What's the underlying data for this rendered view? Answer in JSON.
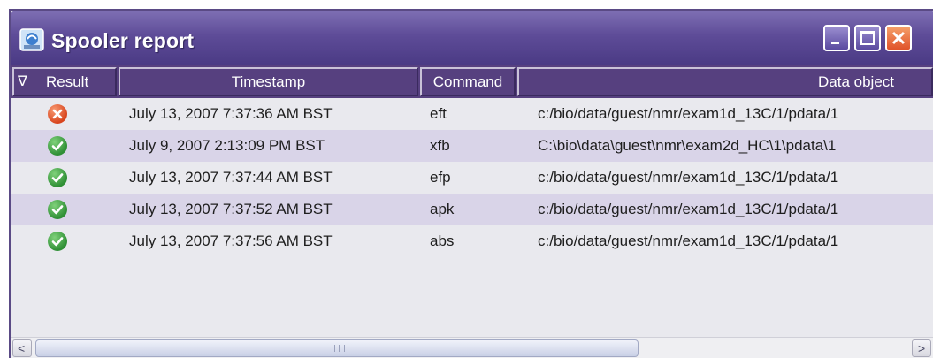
{
  "window": {
    "title": "Spooler report",
    "controls": [
      "minimize-icon",
      "maximize-icon",
      "close-icon"
    ]
  },
  "table": {
    "sort_indicator": "∇",
    "columns": {
      "result": "Result",
      "timestamp": "Timestamp",
      "command": "Command",
      "data_object": "Data object"
    },
    "rows": [
      {
        "status": "error",
        "status_icon": "error-x-icon",
        "timestamp": "July 13, 2007 7:37:36 AM BST",
        "command": "eft",
        "data_object": "c:/bio/data/guest/nmr/exam1d_13C/1/pdata/1"
      },
      {
        "status": "success",
        "status_icon": "checkmark-icon",
        "timestamp": "July 9, 2007 2:13:09 PM BST",
        "command": "xfb",
        "data_object": "C:\\bio\\data\\guest\\nmr\\exam2d_HC\\1\\pdata\\1"
      },
      {
        "status": "success",
        "status_icon": "checkmark-icon",
        "timestamp": "July 13, 2007 7:37:44 AM BST",
        "command": "efp",
        "data_object": "c:/bio/data/guest/nmr/exam1d_13C/1/pdata/1"
      },
      {
        "status": "success",
        "status_icon": "checkmark-icon",
        "timestamp": "July 13, 2007 7:37:52 AM BST",
        "command": "apk",
        "data_object": "c:/bio/data/guest/nmr/exam1d_13C/1/pdata/1"
      },
      {
        "status": "success",
        "status_icon": "checkmark-icon",
        "timestamp": "July 13, 2007 7:37:56 AM BST",
        "command": "abs",
        "data_object": "c:/bio/data/guest/nmr/exam1d_13C/1/pdata/1"
      }
    ]
  },
  "scrollbar": {
    "left_arrow": "<",
    "right_arrow": ">"
  },
  "colors": {
    "titlebar": "#5e4c98",
    "header": "#56407f",
    "alt_row": "#d9d4e8",
    "success": "#2f8f35",
    "error": "#d8451e"
  }
}
